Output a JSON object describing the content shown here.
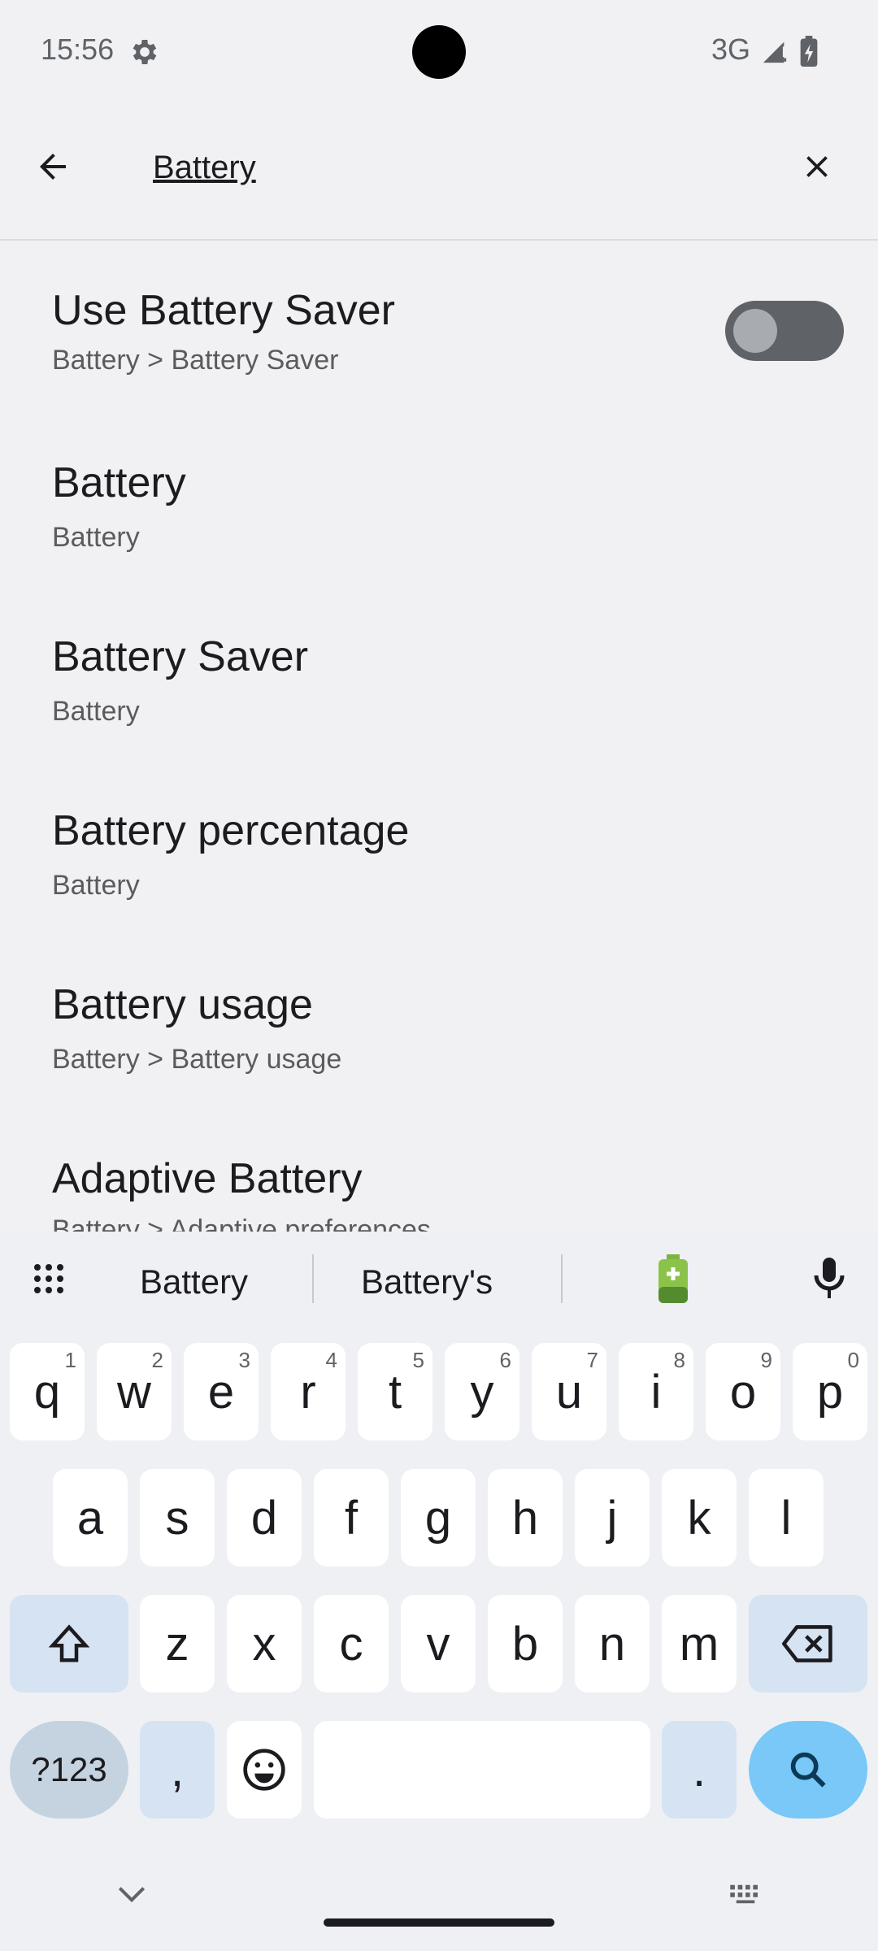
{
  "status": {
    "time": "15:56",
    "network": "3G"
  },
  "search": {
    "query": "Battery"
  },
  "results": [
    {
      "title": "Use Battery Saver",
      "subtitle": "Battery > Battery Saver"
    },
    {
      "title": "Battery",
      "subtitle": "Battery"
    },
    {
      "title": "Battery Saver",
      "subtitle": "Battery"
    },
    {
      "title": "Battery percentage",
      "subtitle": "Battery"
    },
    {
      "title": "Battery usage",
      "subtitle": "Battery > Battery usage"
    },
    {
      "title": "Adaptive Battery",
      "subtitle": "Battery > Adaptive preferences"
    }
  ],
  "keyboard": {
    "suggestions": [
      "Battery",
      "Battery's"
    ],
    "row1": [
      "q",
      "w",
      "e",
      "r",
      "t",
      "y",
      "u",
      "i",
      "o",
      "p"
    ],
    "row1_hints": [
      "1",
      "2",
      "3",
      "4",
      "5",
      "6",
      "7",
      "8",
      "9",
      "0"
    ],
    "row2": [
      "a",
      "s",
      "d",
      "f",
      "g",
      "h",
      "j",
      "k",
      "l"
    ],
    "row3": [
      "z",
      "x",
      "c",
      "v",
      "b",
      "n",
      "m"
    ],
    "sym_label": "?123",
    "comma": ",",
    "period": "."
  },
  "colors": {
    "accent": "#79c8f7",
    "toggle_off": "#5f6368",
    "background": "#f1f1f4"
  }
}
